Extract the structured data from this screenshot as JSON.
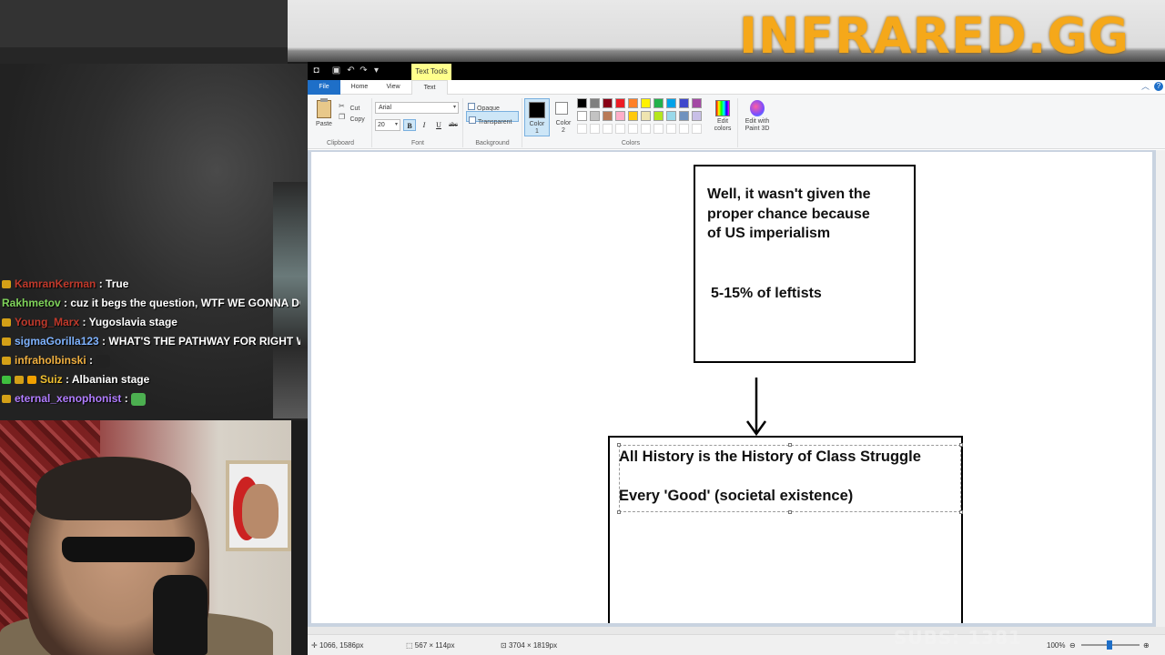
{
  "overlay": {
    "brand": "INFRARED.GG",
    "subs": "SUBS: 1381"
  },
  "chat": [
    {
      "user": "KamranKerman",
      "message": ": True",
      "color": "#c0392b",
      "badges": [
        "#d4a017"
      ]
    },
    {
      "user": "Rakhmetov",
      "message": ": cuz it begs the question, WTF WE GONNA DO ABO",
      "color": "#7fd35a",
      "badges": []
    },
    {
      "user": "Young_Marx",
      "message": ": Yugoslavia stage",
      "color": "#c0392b",
      "badges": [
        "#d4a017"
      ]
    },
    {
      "user": "sigmaGorilla123",
      "message": ": WHAT'S THE PATHWAY FOR RIGHT WING",
      "color": "#7fb3ff",
      "badges": [
        "#d4a017"
      ]
    },
    {
      "user": "infraholbinski",
      "message": ":",
      "color": "#f0b040",
      "badges": [
        "#d4a017"
      ],
      "emote": "dark-emote"
    },
    {
      "user": "Suiz",
      "message": ": Albanian stage",
      "color": "#f0c030",
      "badges": [
        "#3fbf3f",
        "#d4a017",
        "#f0a000"
      ]
    },
    {
      "user": "eternal_xenophonist",
      "message": ":",
      "color": "#b07cff",
      "badges": [
        "#d4a017"
      ],
      "emote": "frog-emote"
    }
  ],
  "paint": {
    "quick_access": [
      "app-icon",
      "save-icon",
      "undo-icon",
      "redo-icon"
    ],
    "contextual_tab": "Text Tools",
    "tabs": [
      "File",
      "Home",
      "View",
      "Text"
    ],
    "clipboard": {
      "paste": "Paste",
      "cut": "Cut",
      "copy": "Copy",
      "label": "Clipboard"
    },
    "font": {
      "family": "Arial",
      "size": "20",
      "label": "Font",
      "bold": "B",
      "italic": "I",
      "underline": "U",
      "strike": "abc"
    },
    "background": {
      "opaque": "Opaque",
      "transparent": "Transparent",
      "label": "Background"
    },
    "colors": {
      "color1": "Color\n1",
      "color1_line1": "Color",
      "color1_line2": "1",
      "color2_line1": "Color",
      "color2_line2": "2",
      "label": "Colors",
      "edit_line1": "Edit",
      "edit_line2": "colors",
      "paint3d_line1": "Edit with",
      "paint3d_line2": "Paint 3D",
      "palette_row1": [
        "#000000",
        "#7f7f7f",
        "#880015",
        "#ed1c24",
        "#ff7f27",
        "#fff200",
        "#22b14c",
        "#00a2e8",
        "#3f48cc",
        "#a349a4"
      ],
      "palette_row2": [
        "#ffffff",
        "#c3c3c3",
        "#b97a57",
        "#ffaec9",
        "#ffc90e",
        "#efe4b0",
        "#b5e61d",
        "#99d9ea",
        "#7092be",
        "#c8bfe7"
      ],
      "palette_row3": [
        "#ffffff",
        "#ffffff",
        "#ffffff",
        "#ffffff",
        "#ffffff",
        "#ffffff",
        "#ffffff",
        "#ffffff",
        "#ffffff",
        "#ffffff"
      ]
    },
    "canvas": {
      "box1_line1": "Well, it wasn't given the",
      "box1_line2": "proper chance because",
      "box1_line3": "of US imperialism",
      "box1_note": "5-15% of leftists",
      "box2_line1": "All History is the History of Class Struggle",
      "box2_line2": "Every 'Good' (societal existence)"
    },
    "status": {
      "cursor": "1066, 1586px",
      "selection": "567 × 114px",
      "image_size": "3704 × 1819px",
      "zoom": "100%"
    }
  }
}
